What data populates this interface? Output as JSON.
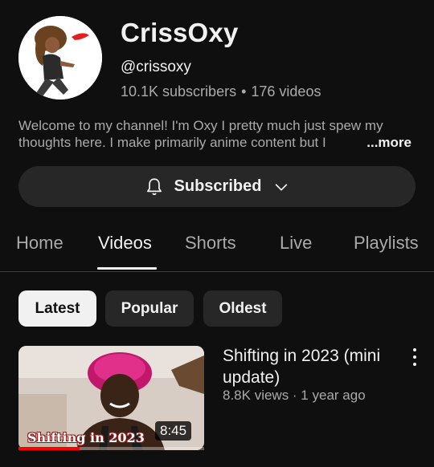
{
  "channel": {
    "name": "CrissOxy",
    "handle": "@crissoxy",
    "subscribers": "10.1K subscribers",
    "videos_count": "176 videos",
    "separator": "•",
    "description_line1": "Welcome to my channel! I'm Oxy I pretty much just spew my",
    "description_line2": "thoughts here. I make primarily anime content but I",
    "more_label": "...more"
  },
  "subscribe": {
    "label": "Subscribed",
    "bell_icon": "bell-icon",
    "chevron_icon": "chevron-down-icon"
  },
  "tabs": [
    {
      "label": "Home",
      "active": false
    },
    {
      "label": "Videos",
      "active": true
    },
    {
      "label": "Shorts",
      "active": false
    },
    {
      "label": "Live",
      "active": false
    },
    {
      "label": "Playlists",
      "active": false
    }
  ],
  "filters": [
    {
      "label": "Latest",
      "selected": true
    },
    {
      "label": "Popular",
      "selected": false
    },
    {
      "label": "Oldest",
      "selected": false
    }
  ],
  "video": {
    "thumbnail_caption": "Shifting in 2023",
    "duration": "8:45",
    "watch_progress": 0.33,
    "title": "Shifting in 2023 (mini update)",
    "meta": "8.8K views · 1 year ago"
  },
  "colors": {
    "background": "#0f0f0f",
    "surface": "#272727",
    "text_primary": "#f1f1f1",
    "text_secondary": "#aaaaaa",
    "progress": "#ff0000"
  }
}
